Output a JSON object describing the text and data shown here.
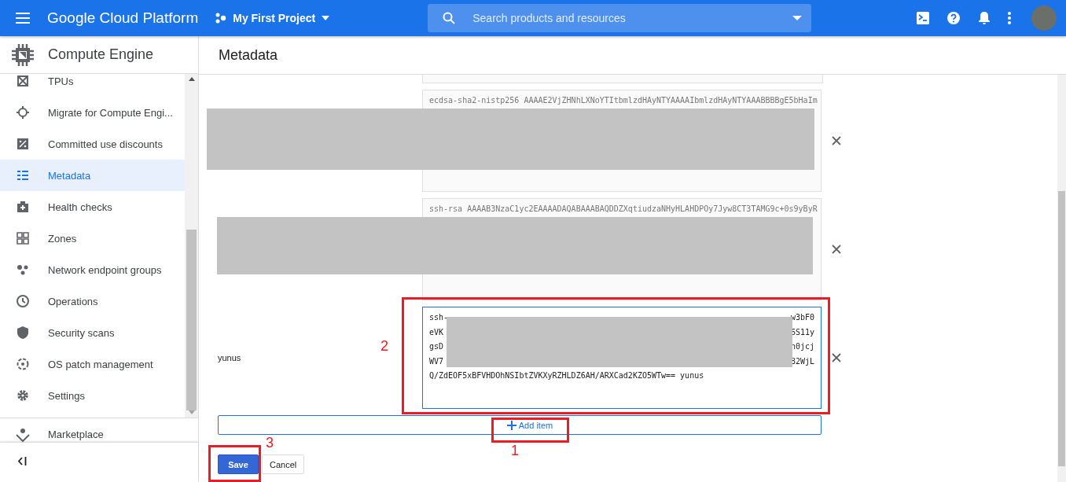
{
  "topbar": {
    "product": "Google Cloud Platform",
    "project": "My First Project",
    "search": {
      "placeholder": "Search products and resources"
    }
  },
  "sidebar": {
    "title": "Compute Engine",
    "items": [
      {
        "label": "TPUs",
        "kind": "tpu",
        "selected": false
      },
      {
        "label": "Migrate for Compute Engi...",
        "kind": "migrate",
        "selected": false
      },
      {
        "label": "Committed use discounts",
        "kind": "percent",
        "selected": false
      },
      {
        "label": "Metadata",
        "kind": "list",
        "selected": true
      },
      {
        "label": "Health checks",
        "kind": "health",
        "selected": false
      },
      {
        "label": "Zones",
        "kind": "grid",
        "selected": false
      },
      {
        "label": "Network endpoint groups",
        "kind": "dots",
        "selected": false
      },
      {
        "label": "Operations",
        "kind": "clock",
        "selected": false
      },
      {
        "label": "Security scans",
        "kind": "shield",
        "selected": false
      },
      {
        "label": "OS patch management",
        "kind": "patch",
        "selected": false
      },
      {
        "label": "Settings",
        "kind": "gear",
        "selected": false
      }
    ],
    "footer_item": {
      "label": "Marketplace"
    }
  },
  "page": {
    "title": "Metadata"
  },
  "metadata": {
    "items": [
      {
        "lines": [
          {
            "text": "ecdsa-sha2-nistp256 AAAAE2VjZHNhLXNoYTItbmlzdHAyNTYAAAAIbmlzdHAyNTYAAABBBBgE5bHaIm"
          }
        ],
        "focused": false
      },
      {
        "lines": [
          {
            "text": "ssh-rsa AAAAB3NzaC1yc2EAAAADAQABAAABAQDDZXqtiudzaNHyHLAHDPOy7Jyw8CT3TAMG9c+0s9yByR"
          }
        ],
        "focused": false
      },
      {
        "key": "yunus",
        "lines": [
          {
            "left": "ssh-",
            "right": "w3bF0"
          },
          {
            "left": "eVK",
            "right": "6S11y"
          },
          {
            "left": "gsD",
            "right": "n0jcj"
          },
          {
            "left": "WV7",
            "right": "82WjL"
          },
          {
            "text": "Q/ZdEOF5xBFVHDOhNSIbtZVKXyRZHLDZ6AH/ARXCad2KZO5WTw== yunus"
          }
        ],
        "focused": true
      }
    ],
    "add_item": "Add item"
  },
  "buttons": [
    {
      "label": "Save",
      "kind": "primary"
    },
    {
      "label": "Cancel",
      "kind": "secondary"
    }
  ],
  "annotations": [
    {
      "label": "1"
    },
    {
      "label": "2"
    },
    {
      "label": "3"
    }
  ]
}
